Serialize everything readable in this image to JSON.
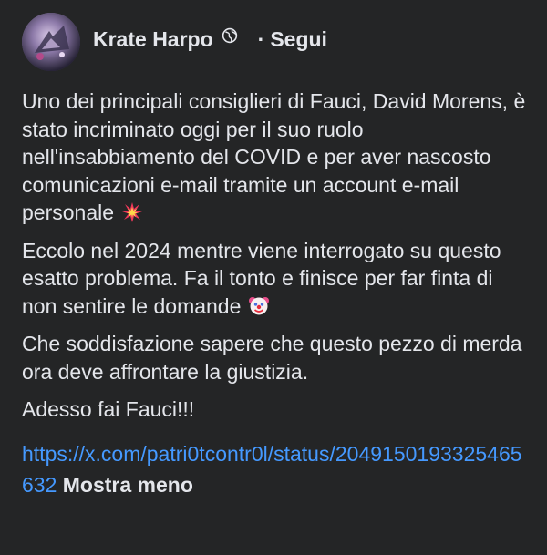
{
  "post": {
    "author": "Krate Harpo",
    "separator": "·",
    "follow_label": "Segui",
    "paragraphs": [
      "Uno dei principali consiglieri di Fauci, David Morens, è stato incriminato oggi per il suo ruolo nell'insabbiamento del COVID e per aver nascosto comunicazioni e-mail tramite un account e-mail personale",
      "Eccolo nel 2024 mentre viene interrogato su questo esatto problema. Fa il tonto e finisce per far finta di non sentire le domande",
      "Che soddisfazione sapere che questo pezzo di merda ora deve affrontare la giustizia.",
      "Adesso fai Fauci!!!"
    ],
    "link_text": "https://x.com/patri0tcontr0l/status/2049150193325465632",
    "see_less_label": "Mostra meno"
  },
  "colors": {
    "background": "#242526",
    "text": "#e4e6eb",
    "link": "#4599ff"
  },
  "icons": {
    "privacy": "globe-icon",
    "emoji_1": "collision-icon",
    "emoji_2": "clown-face-icon"
  }
}
